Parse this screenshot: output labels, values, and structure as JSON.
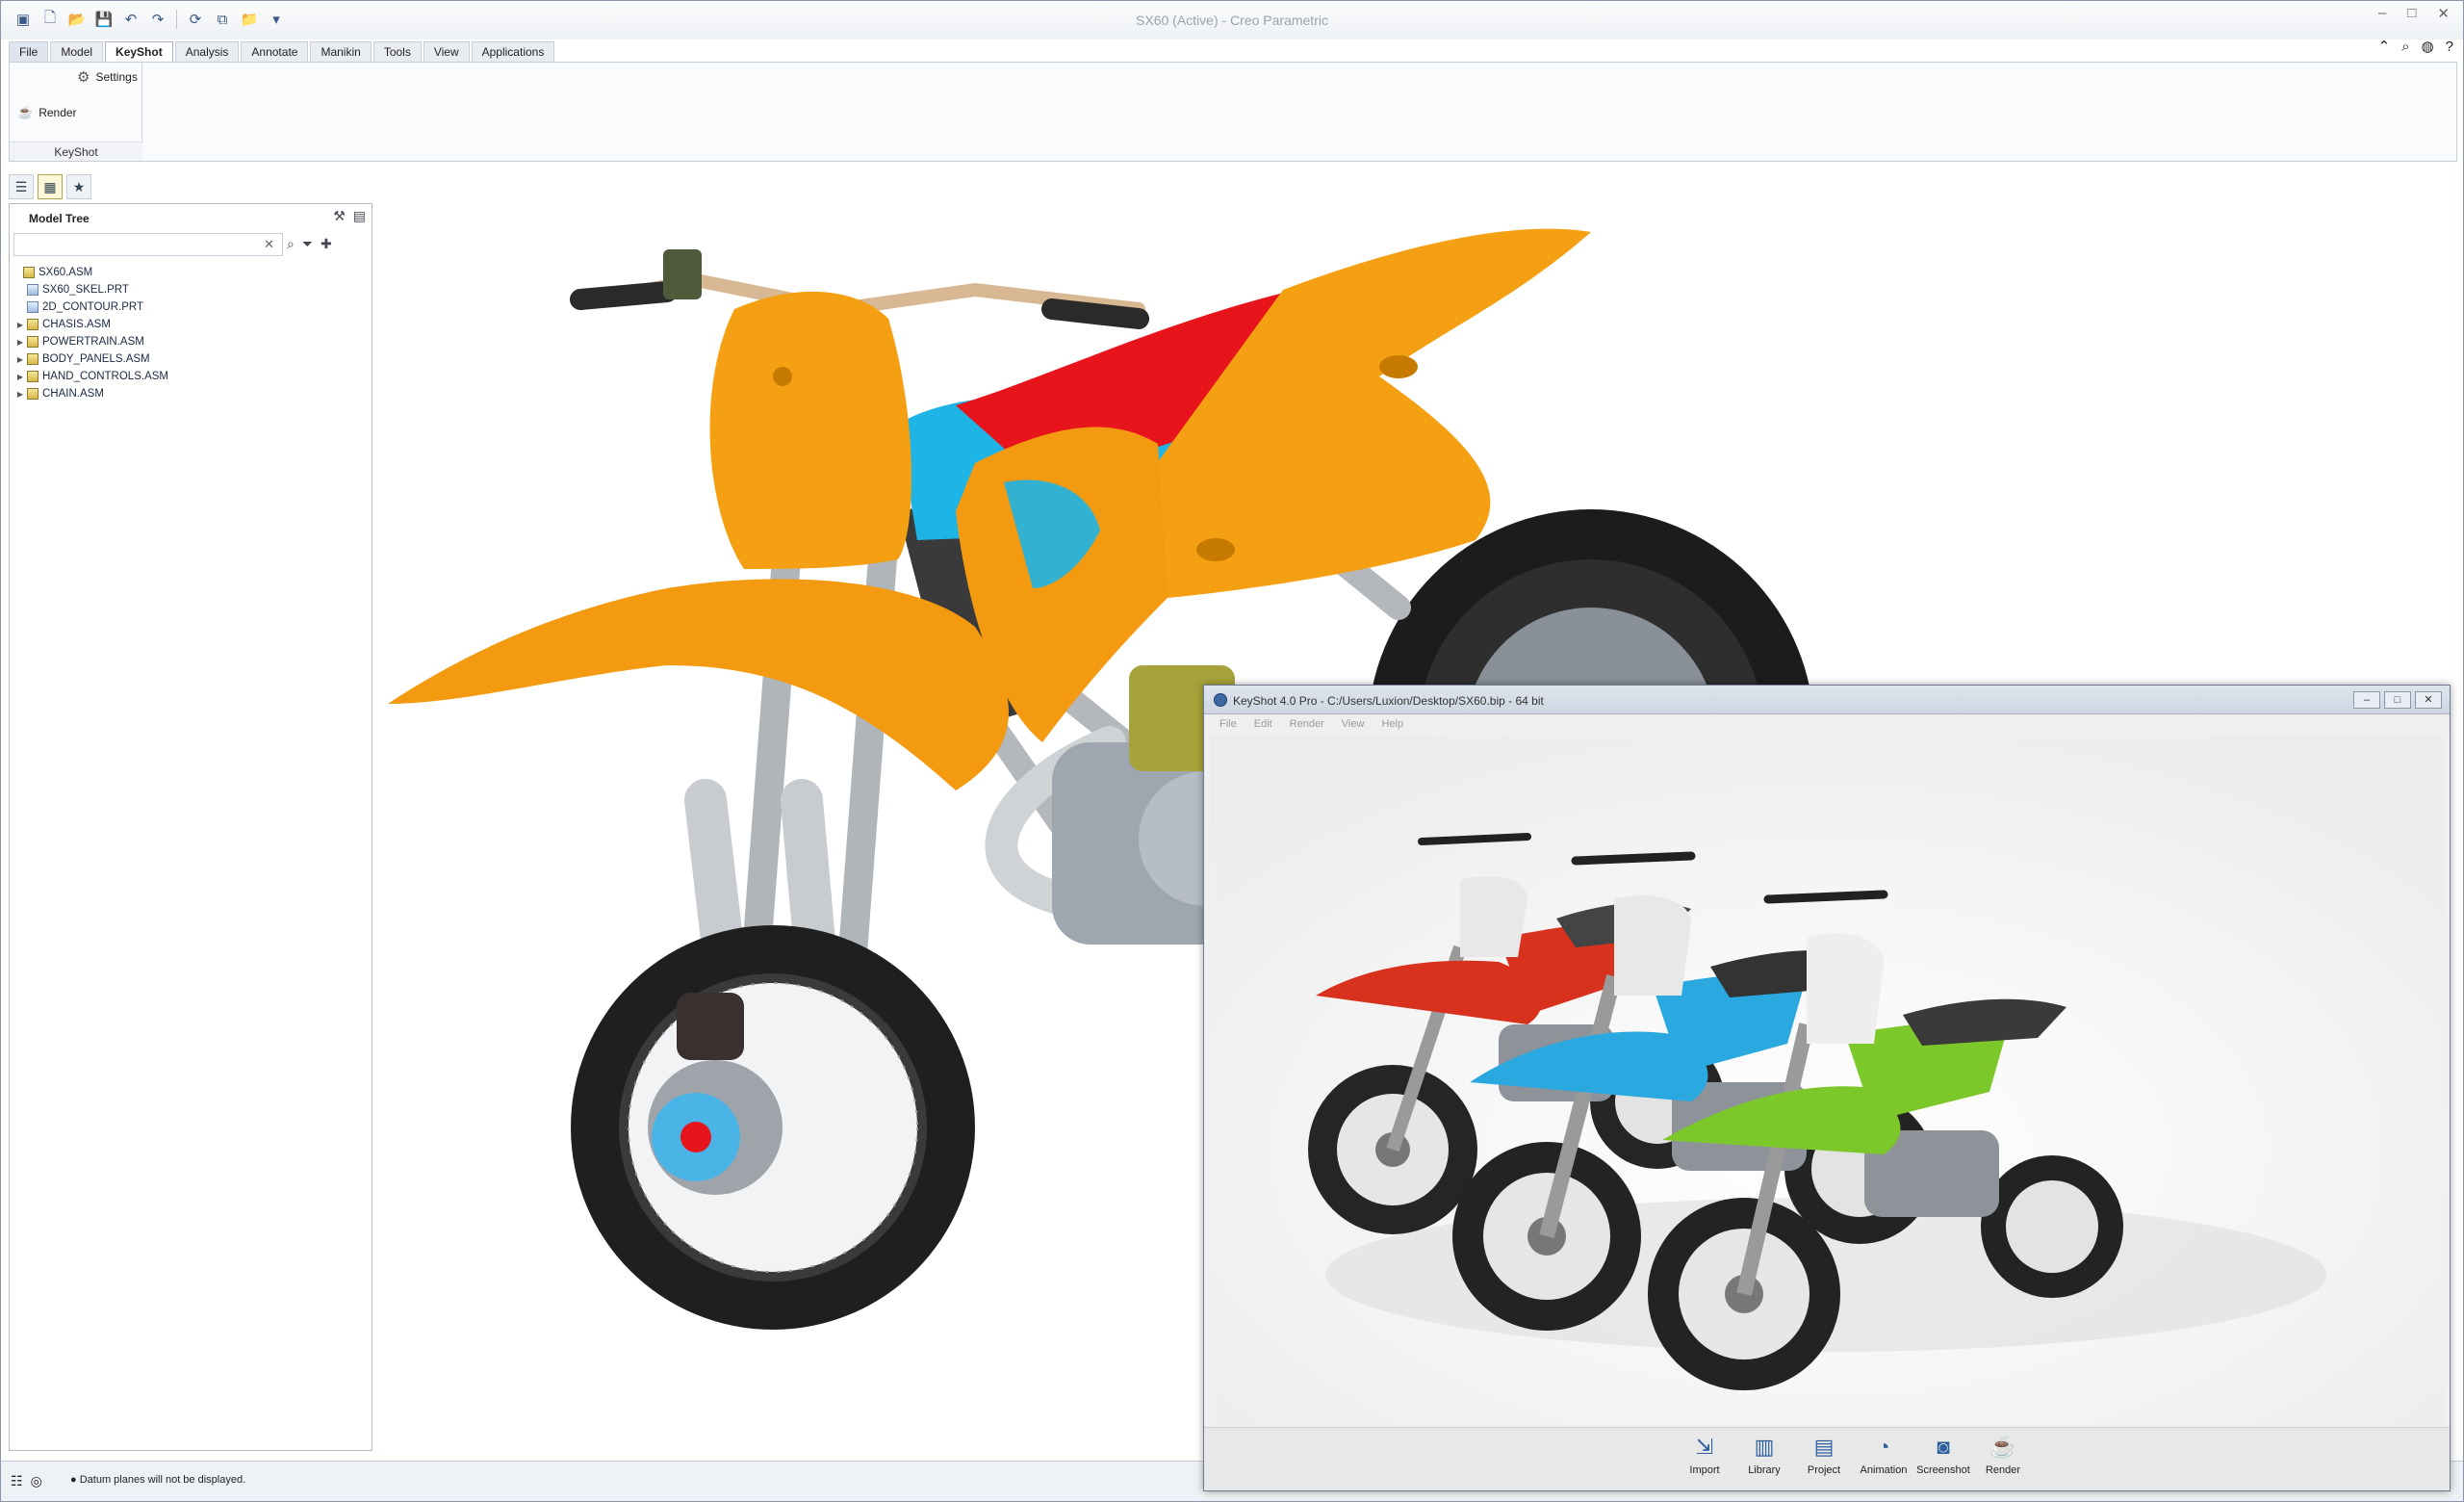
{
  "window": {
    "title": "SX60 (Active) - Creo Parametric"
  },
  "ribbon": {
    "tabs": [
      "File",
      "Model",
      "KeyShot",
      "Analysis",
      "Annotate",
      "Manikin",
      "Tools",
      "View",
      "Applications"
    ],
    "active_tab": "KeyShot",
    "settings_label": "Settings",
    "render_label": "Render",
    "group_label": "KeyShot"
  },
  "model_tree": {
    "title": "Model Tree",
    "items": [
      {
        "label": "SX60.ASM",
        "type": "asm"
      },
      {
        "label": "SX60_SKEL.PRT",
        "type": "prt"
      },
      {
        "label": "2D_CONTOUR.PRT",
        "type": "prt"
      },
      {
        "label": "CHASIS.ASM",
        "type": "asm"
      },
      {
        "label": "POWERTRAIN.ASM",
        "type": "asm"
      },
      {
        "label": "BODY_PANELS.ASM",
        "type": "asm"
      },
      {
        "label": "HAND_CONTROLS.ASM",
        "type": "asm"
      },
      {
        "label": "CHAIN.ASM",
        "type": "asm"
      }
    ]
  },
  "status": {
    "message": "Datum planes will not be displayed."
  },
  "keyshot": {
    "title": "KeyShot 4.0 Pro  - C:/Users/Luxion/Desktop/SX60.bip  - 64 bit",
    "menu": [
      "File",
      "Edit",
      "Render",
      "View",
      "Help"
    ],
    "tools": [
      "Import",
      "Library",
      "Project",
      "Animation",
      "Screenshot",
      "Render"
    ]
  },
  "colors": {
    "fender_orange": "#f4a012",
    "seat_red": "#e8141c",
    "tank_blue": "#1eb4e6",
    "bike_red": "#d8321e",
    "bike_blue": "#2aa8e0",
    "bike_green": "#7cc82a"
  }
}
